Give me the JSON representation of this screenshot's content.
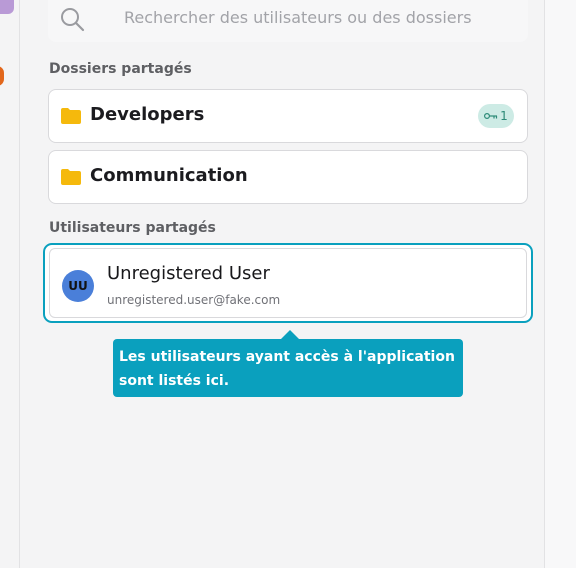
{
  "search": {
    "placeholder": "Rechercher des utilisateurs ou des dossiers"
  },
  "folders_section": {
    "title": "Dossiers partagés",
    "items": [
      {
        "name": "Developers",
        "key_count": "1"
      },
      {
        "name": "Communication"
      }
    ]
  },
  "users_section": {
    "title": "Utilisateurs partagés",
    "items": [
      {
        "initials": "UU",
        "name": "Unregistered User",
        "email": "unregistered.user@fake.com"
      }
    ]
  },
  "tooltip": {
    "text": "Les utilisateurs ayant accès à l'application sont listés ici."
  },
  "colors": {
    "accent": "#0aa0be",
    "folder": "#f5b90c",
    "avatar": "#4a7fd9",
    "badge_bg": "#cdebe5"
  },
  "icons": [
    "search-icon",
    "folder-icon",
    "key-icon"
  ]
}
